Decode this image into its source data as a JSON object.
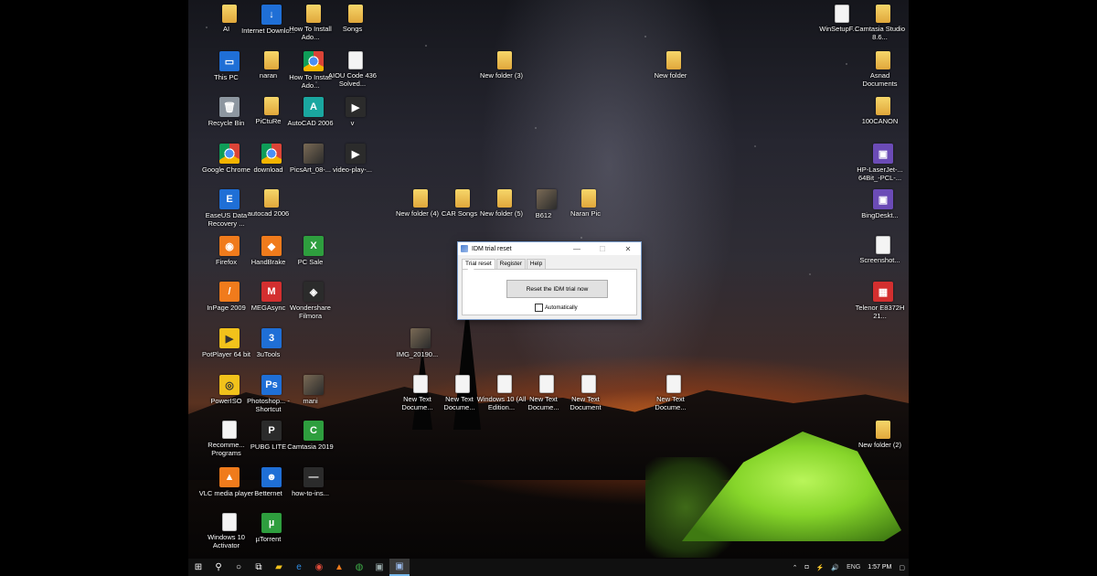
{
  "desktop": {
    "icons": [
      {
        "label": "AI",
        "glyph": "folder",
        "text": ""
      },
      {
        "label": "Internet Downlo...",
        "glyph": "blue",
        "text": "↓"
      },
      {
        "label": "How To Install Ado...",
        "glyph": "folder",
        "text": ""
      },
      {
        "label": "Songs",
        "glyph": "folder",
        "text": ""
      },
      {
        "label": "This PC",
        "glyph": "blue",
        "text": "▭"
      },
      {
        "label": "naran",
        "glyph": "folder",
        "text": ""
      },
      {
        "label": "How To Install Ado...",
        "glyph": "chrome",
        "text": ""
      },
      {
        "label": "AIOU Code 436 Solved...",
        "glyph": "doc",
        "text": ""
      },
      {
        "label": "Recycle Bin",
        "glyph": "gray",
        "text": "🗑"
      },
      {
        "label": "PiCtuRe",
        "glyph": "folder",
        "text": ""
      },
      {
        "label": "AutoCAD 2006",
        "glyph": "teal",
        "text": "A"
      },
      {
        "label": "v",
        "glyph": "dark",
        "text": "▶"
      },
      {
        "label": "Google Chrome",
        "glyph": "chrome",
        "text": ""
      },
      {
        "label": "download",
        "glyph": "chrome",
        "text": ""
      },
      {
        "label": "PicsArt_08-...",
        "glyph": "photo",
        "text": ""
      },
      {
        "label": "video-play-...",
        "glyph": "dark",
        "text": "▶"
      },
      {
        "label": "EaseUS Data Recovery ...",
        "glyph": "blue",
        "text": "E"
      },
      {
        "label": "autocad 2006",
        "glyph": "folder",
        "text": ""
      },
      {
        "label": "Firefox",
        "glyph": "orange",
        "text": "◉"
      },
      {
        "label": "HandBrake",
        "glyph": "orange",
        "text": "◆"
      },
      {
        "label": "PC Sale",
        "glyph": "green",
        "text": "X"
      },
      {
        "label": "InPage 2009",
        "glyph": "orange",
        "text": "/"
      },
      {
        "label": "MEGAsync",
        "glyph": "red",
        "text": "M"
      },
      {
        "label": "Wondershare Filmora",
        "glyph": "dark",
        "text": "◈"
      },
      {
        "label": "PotPlayer 64 bit",
        "glyph": "yellow",
        "text": "▶"
      },
      {
        "label": "3uTools",
        "glyph": "blue",
        "text": "3"
      },
      {
        "label": "PowerISO",
        "glyph": "yellow",
        "text": "◎"
      },
      {
        "label": "Photoshop... - Shortcut",
        "glyph": "blue",
        "text": "Ps"
      },
      {
        "label": "mani",
        "glyph": "photo",
        "text": ""
      },
      {
        "label": "Recomme... Programs",
        "glyph": "doc",
        "text": ""
      },
      {
        "label": "PUBG LITE",
        "glyph": "dark",
        "text": "P"
      },
      {
        "label": "Camtasia 2019",
        "glyph": "green",
        "text": "C"
      },
      {
        "label": "VLC media player",
        "glyph": "orange",
        "text": "▲"
      },
      {
        "label": "Betternet",
        "glyph": "blue",
        "text": "☻"
      },
      {
        "label": "how-to-ins...",
        "glyph": "dark",
        "text": "—"
      },
      {
        "label": "Windows 10 Activator",
        "glyph": "doc",
        "text": ""
      },
      {
        "label": "µTorrent",
        "glyph": "green",
        "text": "µ"
      },
      {
        "label": "New folder (3)",
        "glyph": "folder",
        "text": ""
      },
      {
        "label": "New folder",
        "glyph": "folder",
        "text": ""
      },
      {
        "label": "New folder (4)",
        "glyph": "folder",
        "text": ""
      },
      {
        "label": "CAR Songs",
        "glyph": "folder",
        "text": ""
      },
      {
        "label": "New folder (5)",
        "glyph": "folder",
        "text": ""
      },
      {
        "label": "B612",
        "glyph": "photo",
        "text": ""
      },
      {
        "label": "Naran Pic",
        "glyph": "folder",
        "text": ""
      },
      {
        "label": "IMG_20190...",
        "glyph": "photo",
        "text": ""
      },
      {
        "label": "New Text Docume...",
        "glyph": "doc",
        "text": ""
      },
      {
        "label": "New Text Docume...",
        "glyph": "doc",
        "text": ""
      },
      {
        "label": "Windows 10 (All Edition...",
        "glyph": "doc",
        "text": ""
      },
      {
        "label": "New Text Docume...",
        "glyph": "doc",
        "text": ""
      },
      {
        "label": "New Text Document",
        "glyph": "doc",
        "text": ""
      },
      {
        "label": "New Text Docume...",
        "glyph": "doc",
        "text": ""
      },
      {
        "label": "WinSetupF...",
        "glyph": "doc",
        "text": ""
      },
      {
        "label": "Camtasia Studio 8.6...",
        "glyph": "folder",
        "text": ""
      },
      {
        "label": "Asnad Documents",
        "glyph": "folder",
        "text": ""
      },
      {
        "label": "100CANON",
        "glyph": "folder",
        "text": ""
      },
      {
        "label": "HP-LaserJet-... 64Bit_-PCL-...",
        "glyph": "purple",
        "text": "▣"
      },
      {
        "label": "BingDeskt...",
        "glyph": "purple",
        "text": "▣"
      },
      {
        "label": "Screenshot...",
        "glyph": "doc",
        "text": ""
      },
      {
        "label": "Telenor E8372H 21...",
        "glyph": "red",
        "text": "▦"
      },
      {
        "label": "New folder (2)",
        "glyph": "folder",
        "text": ""
      }
    ]
  },
  "dialog": {
    "title": "IDM trial reset",
    "minimize": "—",
    "maximize": "☐",
    "close": "✕",
    "tabs": [
      "Trial reset",
      "Register",
      "Help"
    ],
    "reset_button": "Reset the IDM trial now",
    "auto_label": "Automatically"
  },
  "taskbar": {
    "start": "⊞",
    "search": "⚲",
    "cortana": "○",
    "taskview": "⧉",
    "apps": [
      "▰",
      "e",
      "◉",
      "▲",
      "◍",
      "▣",
      "▣"
    ],
    "tray": [
      "⌃",
      "◘",
      "⚡",
      "🔊",
      "ENG"
    ],
    "time": "1:57 PM",
    "notifications": "▢"
  }
}
